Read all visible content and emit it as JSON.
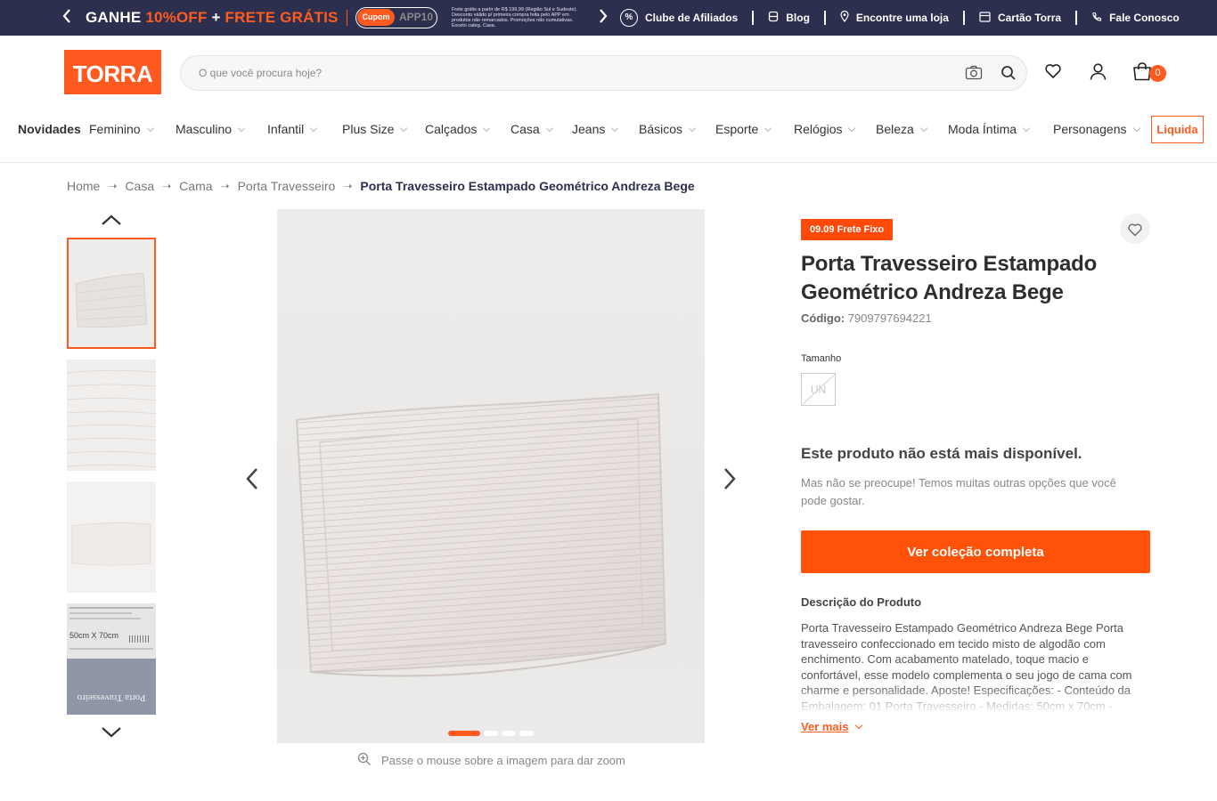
{
  "promo_bar": {
    "promo_part1": "GANHE ",
    "promo_part2": "10%OFF",
    "promo_part3": " + ",
    "promo_part4": "FRETE GRÁTIS",
    "coupon_tag": "Cupom",
    "coupon_code": "APP10",
    "fine_print": "Frete grátis a partir de R$ 199,99 (Região Sul e Sudeste). Desconto válido p/ primeira compra feita pelo APP em produtos não remarcados. Promoções não cumulativas. Exceto categ. Casa.",
    "links": [
      {
        "label": "Clube de Afiliados",
        "icon": "percent-icon"
      },
      {
        "label": "Blog",
        "icon": "blog-icon"
      },
      {
        "label": "Encontre uma loja",
        "icon": "location-pin-icon"
      },
      {
        "label": "Cartão Torra",
        "icon": "card-icon"
      },
      {
        "label": "Fale Conosco",
        "icon": "phone-icon"
      }
    ]
  },
  "header": {
    "logo_text": "TORRA",
    "search_placeholder": "O que você procura hoje?",
    "cart_count": "0"
  },
  "nav": {
    "items": [
      "Novidades",
      "Feminino",
      "Masculino",
      "Infantil",
      "Plus Size",
      "Calçados",
      "Casa",
      "Jeans",
      "Básicos",
      "Esporte",
      "Relógios",
      "Beleza",
      "Moda Íntima",
      "Personagens"
    ],
    "liquida": "Liquida"
  },
  "breadcrumb": [
    "Home",
    "Casa",
    "Cama",
    "Porta Travesseiro",
    "Porta Travesseiro Estampado Geométrico Andreza Bege"
  ],
  "gallery": {
    "thumb4_top_text": "50cm X 70cm",
    "thumb4_bottom_text": "Porta Travesseiro",
    "zoom_hint": "Passe o mouse sobre a imagem para dar zoom"
  },
  "product": {
    "flag": "09.09 Frete Fixo",
    "title": "Porta Travesseiro Estampado Geométrico Andreza Bege",
    "code_label": "Código:",
    "code_value": "7909797694221",
    "size_label": "Tamanho",
    "size_option": "UN",
    "unavailable_title": "Este produto não está mais disponível.",
    "unavailable_sub": "Mas não se preocupe! Temos muitas outras opções que você pode gostar.",
    "cta": "Ver coleção completa",
    "description_title": "Descrição do Produto",
    "description": "Porta Travesseiro Estampado Geométrico Andreza Bege Porta travesseiro confeccionado em tecido misto de algodão com enchimento. Com acabamento matelado, toque macio e confortável, esse modelo complementa o seu jogo de cama com charme e personalidade. Aposte! Especificações: - Conteúdo da Embalagem: 01 Porta Travesseiro - Medidas: 50cm x 70cm -",
    "ver_mais": "Ver mais"
  },
  "colors": {
    "accent": "#ff5a1f",
    "topbar": "#2d2f4f"
  }
}
